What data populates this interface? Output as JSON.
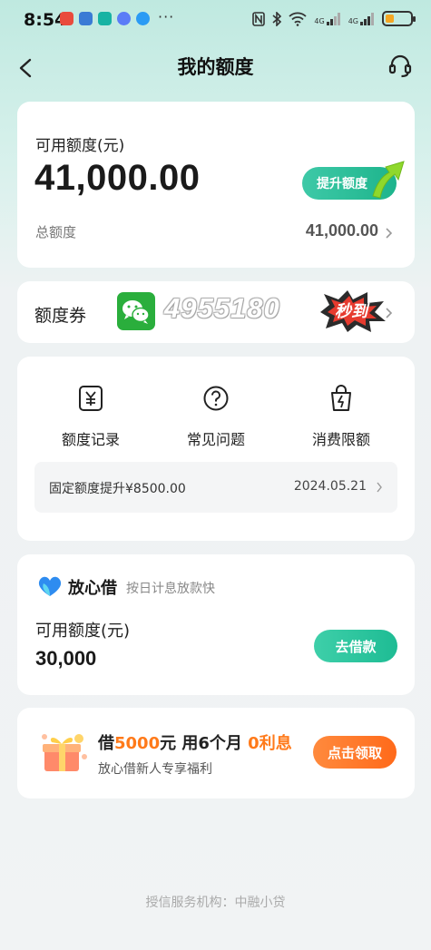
{
  "status_bar": {
    "time": "8:54",
    "more": "···",
    "network_1": "4G",
    "network_2": "4G",
    "battery_level": 0.35
  },
  "nav": {
    "title": "我的额度"
  },
  "quota": {
    "available_label": "可用额度(元)",
    "available_amount": "41,000.00",
    "raise_button": "提升额度",
    "total_label": "总额度",
    "total_value": "41,000.00"
  },
  "coupon": {
    "label": "额度券",
    "overlay_number": "4955180",
    "badge_text": "秒到"
  },
  "menu": {
    "items": [
      {
        "label": "额度记录",
        "icon": "yuan-record-icon"
      },
      {
        "label": "常见问题",
        "icon": "question-icon"
      },
      {
        "label": "消费限额",
        "icon": "lightning-bag-icon"
      }
    ],
    "notice": {
      "text": "固定额度提升¥8500.00",
      "date": "2024.05.21"
    }
  },
  "loan": {
    "brand_name": "放心借",
    "slogan": "按日计息放款快",
    "available_label": "可用额度(元)",
    "available_amount": "30,000",
    "borrow_button": "去借款"
  },
  "promo": {
    "part1": "借",
    "amount": "5000",
    "part2": "元 用6个月 ",
    "interest": "0利息",
    "subtitle": "放心借新人专享福利",
    "claim_button": "点击领取"
  },
  "footer": {
    "text": "授信服务机构：中融小贷"
  },
  "colors": {
    "accent_green": "#1db48c",
    "accent_orange": "#ff7a1a"
  }
}
